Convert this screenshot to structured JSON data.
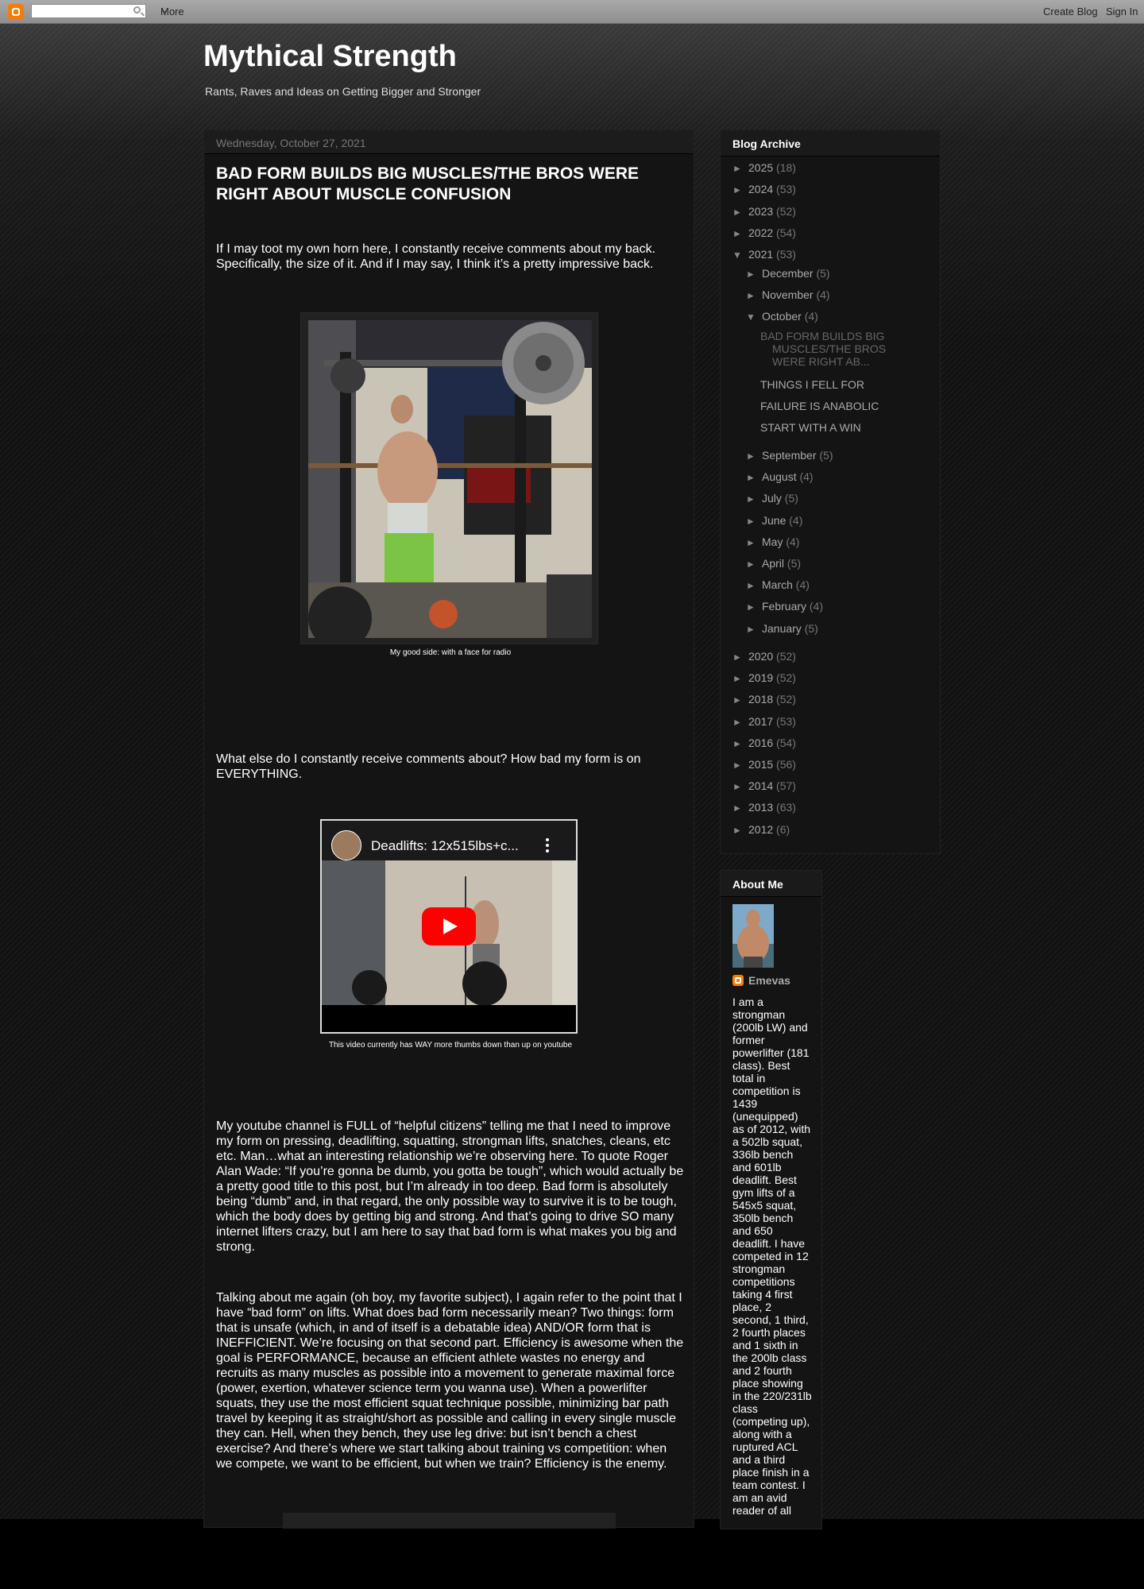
{
  "navbar": {
    "search_placeholder": "",
    "more_label": "More",
    "create_blog_label": "Create Blog",
    "sign_in_label": "Sign In"
  },
  "header": {
    "title": "Mythical Strength",
    "description": "Rants, Raves and Ideas on Getting Bigger and Stronger"
  },
  "post": {
    "date": "Wednesday, October 27, 2021",
    "title": "BAD FORM BUILDS BIG MUSCLES/THE BROS WERE RIGHT ABOUT MUSCLE CONFUSION",
    "para1": "If I may toot my own horn here, I constantly receive comments about my back. Specifically, the size of it.  And if I may say, I think it’s a pretty impressive back.",
    "image_caption": "My good side: with a face for radio",
    "para2": "What else do I constantly receive comments about?  How bad my form is on EVERYTHING.",
    "video_title": "Deadlifts: 12x515lbs+c...",
    "video_caption": "This video currently has WAY more thumbs down than up on youtube",
    "para3": "My youtube channel is FULL of “helpful citizens” telling me that I need to improve my form on pressing, deadlifting, squatting, strongman lifts, snatches, cleans, etc etc.  Man…what an interesting relationship we’re observing here.  To quote Roger Alan Wade: “If you’re gonna be dumb, you gotta be tough”, which would actually be a pretty good title to this post, but I’m already in too deep.  Bad form is absolutely being “dumb” and, in that regard, the only possible way to survive it is to be tough, which the body does by getting big and strong.  And that’s going to drive SO many internet lifters crazy, but I am here to say that bad form is what makes you big and strong.",
    "para4": "Talking about me again (oh boy, my favorite subject), I again refer to the point that I have “bad form” on lifts.  What does bad form necessarily mean?  Two things: form that is unsafe (which, in and of itself is a debatable idea) AND/OR form that is INEFFICIENT.  We’re focusing on that second part.  Efficiency is awesome when the goal is PERFORMANCE, because an efficient athlete wastes no energy and recruits as many muscles as possible into a movement to generate maximal force (power, exertion, whatever science term you wanna use).  When a powerlifter squats, they use the most efficient squat technique possible, minimizing bar path travel by keeping it as straight/short as possible and calling in every single muscle they can.  Hell, when they bench, they use leg drive: but isn’t bench a chest exercise?  And there’s where we start talking about training vs competition: when we compete, we want to be efficient, but when we train?  Efficiency is the enemy."
  },
  "archive": {
    "title": "Blog Archive",
    "years_top": [
      {
        "label": "2025",
        "count": "(18)",
        "expanded": false
      },
      {
        "label": "2024",
        "count": "(53)",
        "expanded": false
      },
      {
        "label": "2023",
        "count": "(52)",
        "expanded": false
      },
      {
        "label": "2022",
        "count": "(54)",
        "expanded": false
      },
      {
        "label": "2021",
        "count": "(53)",
        "expanded": true
      }
    ],
    "months_before": [
      {
        "label": "December",
        "count": "(5)"
      },
      {
        "label": "November",
        "count": "(4)"
      }
    ],
    "current_month": {
      "label": "October",
      "count": "(4)"
    },
    "posts": [
      "BAD FORM BUILDS BIG MUSCLES/THE BROS WERE RIGHT AB...",
      "THINGS I FELL FOR",
      "FAILURE IS ANABOLIC",
      "START WITH A WIN"
    ],
    "months_after": [
      {
        "label": "September",
        "count": "(5)"
      },
      {
        "label": "August",
        "count": "(4)"
      },
      {
        "label": "July",
        "count": "(5)"
      },
      {
        "label": "June",
        "count": "(4)"
      },
      {
        "label": "May",
        "count": "(4)"
      },
      {
        "label": "April",
        "count": "(5)"
      },
      {
        "label": "March",
        "count": "(4)"
      },
      {
        "label": "February",
        "count": "(4)"
      },
      {
        "label": "January",
        "count": "(5)"
      }
    ],
    "years_bottom": [
      {
        "label": "2020",
        "count": "(52)"
      },
      {
        "label": "2019",
        "count": "(52)"
      },
      {
        "label": "2018",
        "count": "(52)"
      },
      {
        "label": "2017",
        "count": "(53)"
      },
      {
        "label": "2016",
        "count": "(54)"
      },
      {
        "label": "2015",
        "count": "(56)"
      },
      {
        "label": "2014",
        "count": "(57)"
      },
      {
        "label": "2013",
        "count": "(63)"
      },
      {
        "label": "2012",
        "count": "(6)"
      }
    ],
    "collapsed_glyph": "►",
    "expanded_glyph": "▼"
  },
  "about": {
    "title": "About Me",
    "name": "Emevas",
    "bio": "I am a strongman (200lb LW) and former powerlifter (181 class). Best total in competition is 1439 (unequipped) as of 2012, with a 502lb squat, 336lb bench and 601lb deadlift. Best gym lifts of a 545x5 squat, 350lb bench and 650 deadlift. I have competed in 12 strongman competitions taking 4 first place, 2 second, 1 third, 2 fourth places and 1 sixth in the 200lb class and 2 fourth place showing in the 220/231lb class (competing up), along with a ruptured ACL and a third place finish in a team contest. I am an avid reader of all"
  },
  "colors": {
    "brand_orange": "#f57d00",
    "youtube_red": "#ff0000",
    "background": "#111111"
  }
}
